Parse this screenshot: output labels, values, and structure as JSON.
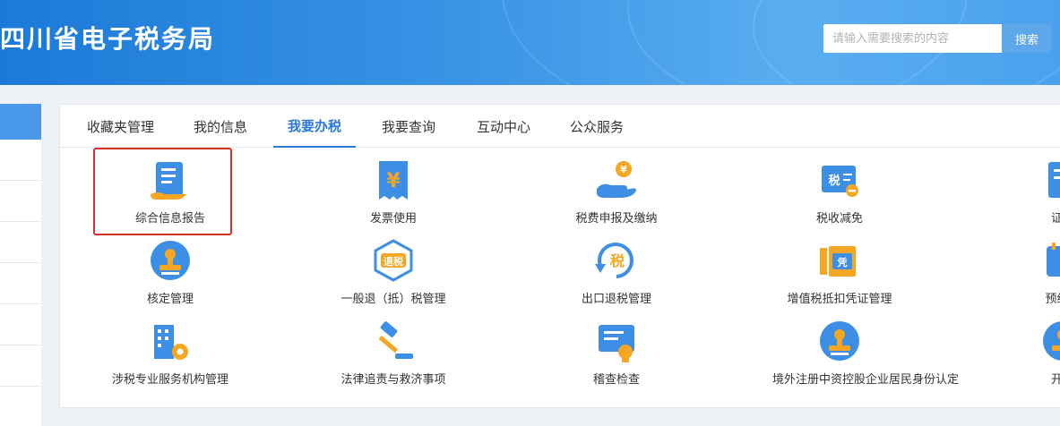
{
  "header": {
    "title": "四川省电子税务局"
  },
  "search": {
    "placeholder": "请输入需要搜索的内容",
    "button_label": "搜索"
  },
  "tabs": [
    {
      "label": "收藏夹管理"
    },
    {
      "label": "我的信息"
    },
    {
      "label": "我要办税"
    },
    {
      "label": "我要查询"
    },
    {
      "label": "互动中心"
    },
    {
      "label": "公众服务"
    }
  ],
  "active_tab": "我要办税",
  "items": [
    {
      "label": "综合信息报告",
      "icon": "document-scroll-icon"
    },
    {
      "label": "发票使用",
      "icon": "invoice-yen-icon"
    },
    {
      "label": "税费申报及缴纳",
      "icon": "hand-coin-icon"
    },
    {
      "label": "税收减免",
      "icon": "tax-reduction-icon"
    },
    {
      "label": "证明",
      "icon": "certificate-icon"
    },
    {
      "label": "核定管理",
      "icon": "stamp-icon"
    },
    {
      "label": "一般退（抵）税管理",
      "icon": "tax-refund-icon"
    },
    {
      "label": "出口退税管理",
      "icon": "export-refund-icon"
    },
    {
      "label": "增值税抵扣凭证管理",
      "icon": "voucher-icon"
    },
    {
      "label": "预约定",
      "icon": "calendar-icon"
    },
    {
      "label": "涉税专业服务机构管理",
      "icon": "building-gear-icon"
    },
    {
      "label": "法律追责与救济事项",
      "icon": "gavel-icon"
    },
    {
      "label": "稽查检查",
      "icon": "inspection-icon"
    },
    {
      "label": "境外注册中资控股企业居民身份认定",
      "icon": "stamp-icon"
    },
    {
      "label": "开票",
      "icon": "stamp-icon"
    }
  ],
  "colors": {
    "header_blue": "#2b86e0",
    "active_tab": "#2b78d6",
    "highlight_border": "#d9302a",
    "icon_blue": "#3d8fe6",
    "icon_orange": "#f5a623"
  }
}
